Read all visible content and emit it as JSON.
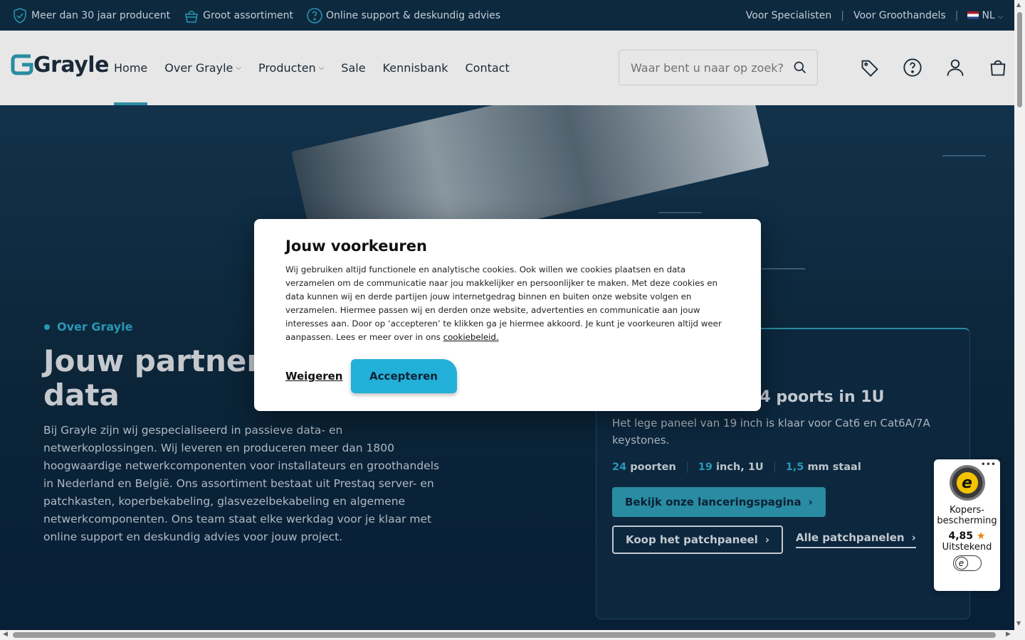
{
  "topbar": {
    "usps": [
      "Meer dan 30 jaar producent",
      "Groot assortiment",
      "Online support & deskundig advies"
    ],
    "links": [
      "Voor Specialisten",
      "Voor Groothandels"
    ],
    "lang": "NL",
    "separator": "|"
  },
  "header": {
    "logo": "Grayle",
    "nav": [
      {
        "label": "Home",
        "dropdown": false,
        "active": true
      },
      {
        "label": "Over Grayle",
        "dropdown": true
      },
      {
        "label": "Producten",
        "dropdown": true
      },
      {
        "label": "Sale",
        "dropdown": false
      },
      {
        "label": "Kennisbank",
        "dropdown": false
      },
      {
        "label": "Contact",
        "dropdown": false
      }
    ],
    "search_placeholder": "Waar bent u naar op zoek?",
    "icons": [
      "tag-icon",
      "help-icon",
      "user-icon",
      "cart-icon"
    ]
  },
  "hero": {
    "eyebrow": "Over Grayle",
    "title": "Jouw partner in passieve data",
    "text": "Bij Grayle zijn wij gespecialiseerd in passieve data- en netwerkoplossingen. Wij leveren en produceren meer dan 1800 hoogwaardige netwerkcomponenten voor installateurs en groothandels in Nederland en België. Ons assortiment bestaat uit Prestaq server- en patchkasten, koperbekabeling, glasvezelbekabeling en algemene netwerkcomponenten. Ons team staat elke werkdag voor je klaar met online support en deskundig advies voor jouw project."
  },
  "card": {
    "title_visible": "e patchpaneel, 24 poorts in 1U",
    "subtitle": "Het lege paneel van 19 inch is klaar voor Cat6 en Cat6A/7A keystones.",
    "specs": [
      {
        "n": "24",
        "label": "poorten"
      },
      {
        "n": "19",
        "label": "inch, 1U"
      },
      {
        "n": "1,5",
        "label": "mm staal"
      }
    ],
    "primary_btn": "Bekijk onze lanceringspagina",
    "outline_btn": "Koop het patchpaneel",
    "link": "Alle patchpanelen"
  },
  "cookie": {
    "title": "Jouw voorkeuren",
    "body": "Wij gebruiken altijd functionele en analytische cookies. Ook willen we cookies plaatsen en data verzamelen om de communicatie naar jou makkelijker en persoonlijker te maken. Met deze cookies en data kunnen wij en derde partijen jouw internetgedrag binnen en buiten onze website volgen en verzamelen. Hiermee passen wij en derden onze website, advertenties en communicatie aan jouw interesses aan. Door op ‘accepteren’ te klikken ga je hiermee akkoord. Je kunt je voorkeuren altijd weer aanpassen. Lees er meer over in ons ",
    "link": "cookiebeleid.",
    "reject": "Weigeren",
    "accept": "Accepteren"
  },
  "trusted": {
    "dots": "•••",
    "label": "Kopers-bescherming",
    "score": "4,85",
    "star": "★",
    "quality": "Uitstekend"
  },
  "colors": {
    "accent": "#2a8fa6",
    "cookie_accept": "#23b0d8",
    "hero_bg": "#0c2539",
    "header_bg": "#ececec"
  }
}
